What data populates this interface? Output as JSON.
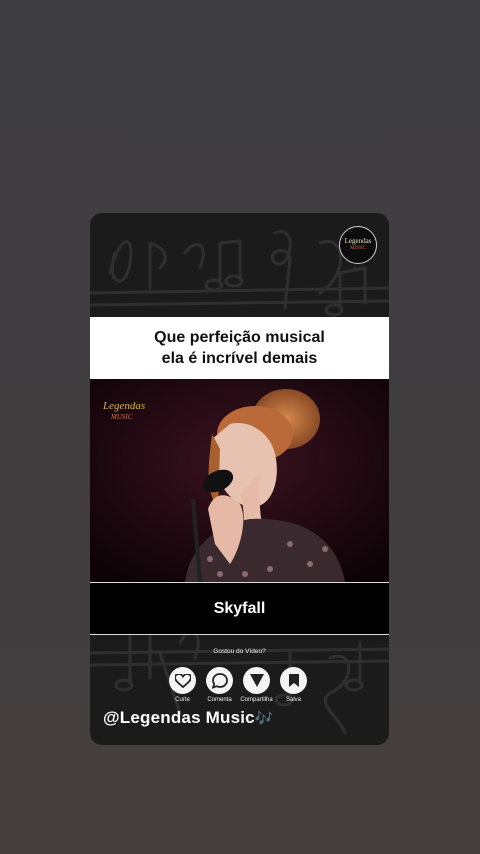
{
  "logo": {
    "line1": "Legendas",
    "line2": "MUSIC"
  },
  "caption": {
    "line1": "Que perfeição musical",
    "line2": "ela é incrível demais"
  },
  "video": {
    "watermark": "Legendas",
    "watermark_sub": "MUSIC"
  },
  "song_title": "Skyfall",
  "prompt": "Gostou do Vídeo?",
  "actions": [
    {
      "label": "Curte",
      "icon": "heart-icon"
    },
    {
      "label": "Comenta",
      "icon": "comment-icon"
    },
    {
      "label": "Compartilha",
      "icon": "share-icon"
    },
    {
      "label": "Salva",
      "icon": "bookmark-icon"
    }
  ],
  "handle": "@Legendas Music",
  "handle_emoji": "🎶",
  "colors": {
    "page_bg": "#3f3d3f",
    "card_bg": "#1b1b1b",
    "caption_bg": "#ffffff",
    "title_bar_bg": "#000000"
  }
}
